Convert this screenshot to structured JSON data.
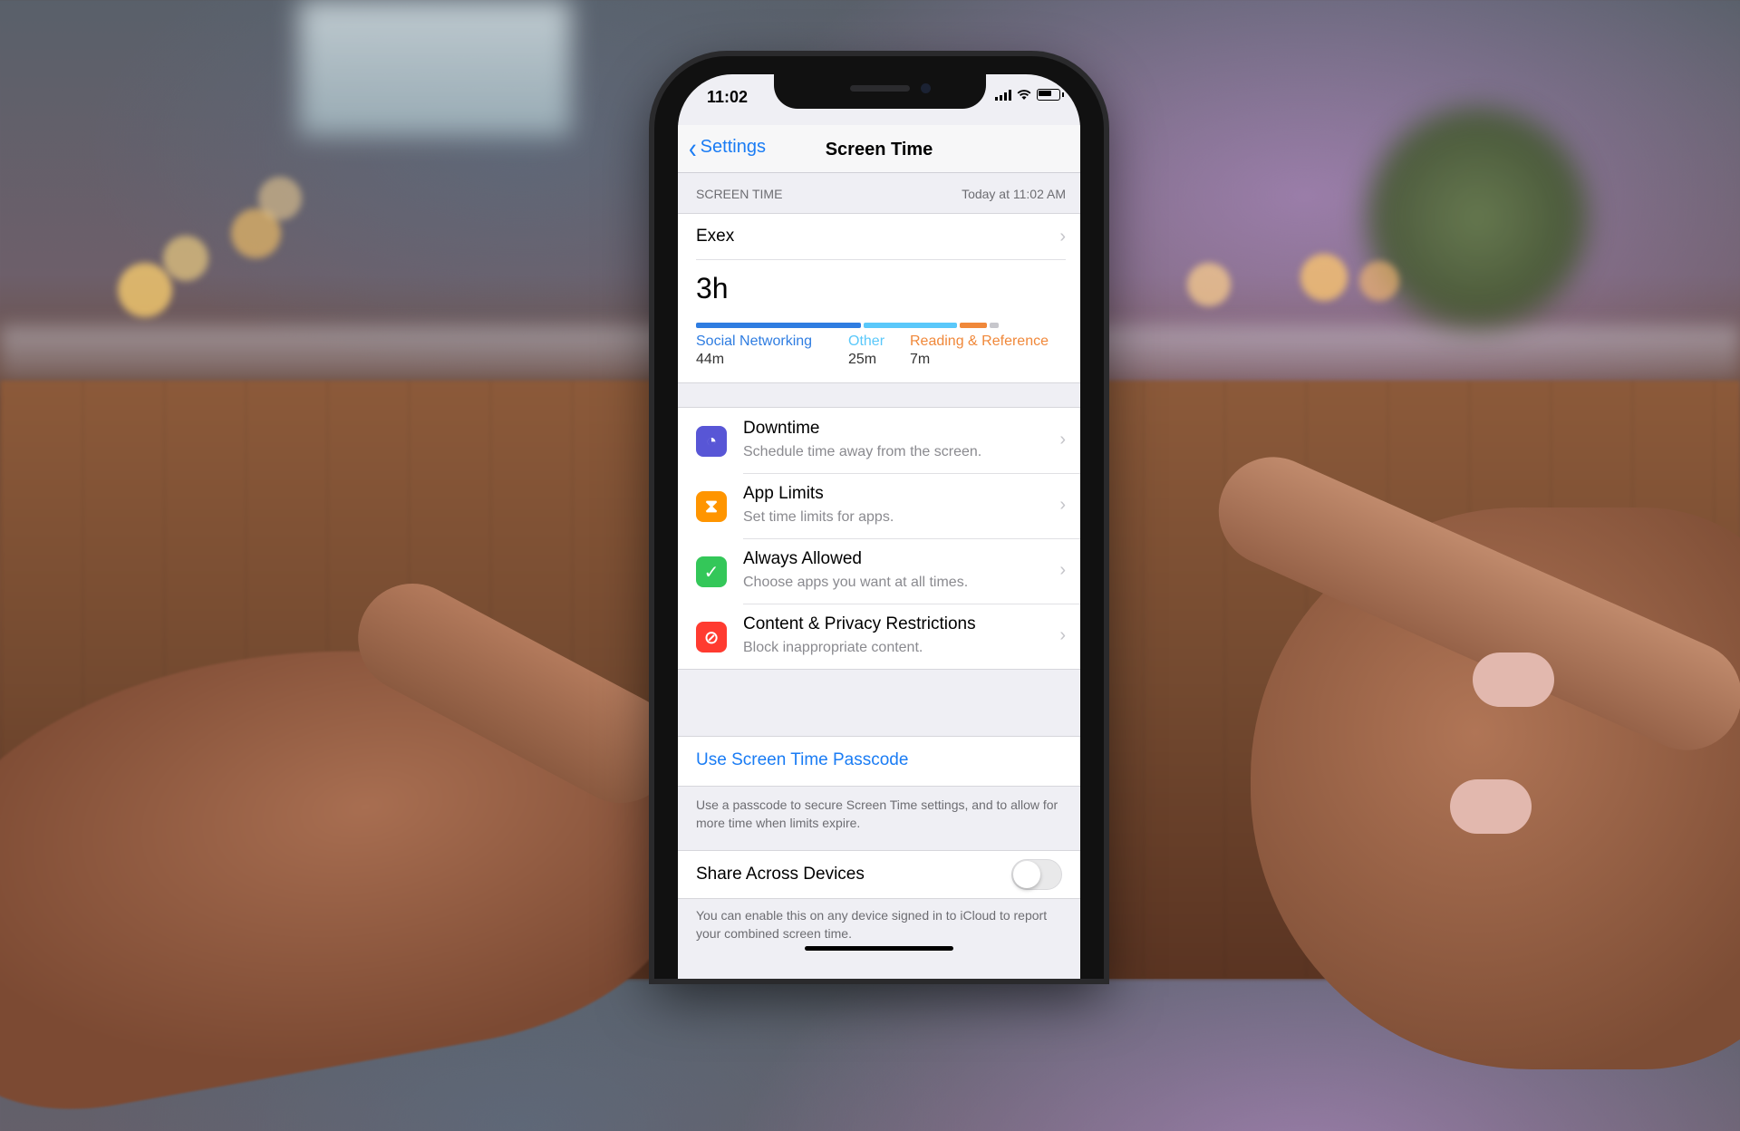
{
  "status_bar": {
    "time": "11:02",
    "icons": [
      "cellular-signal-icon",
      "wifi-icon",
      "battery-icon"
    ]
  },
  "nav": {
    "back_label": "Settings",
    "title": "Screen Time"
  },
  "summary": {
    "section_label": "SCREEN TIME",
    "updated": "Today at 11:02 AM",
    "device": "Exex",
    "total": "3h",
    "categories": [
      {
        "name": "Social Networking",
        "time": "44m",
        "color": "#2f7de1"
      },
      {
        "name": "Other",
        "time": "25m",
        "color": "#5ac8fa"
      },
      {
        "name": "Reading & Reference",
        "time": "7m",
        "color": "#f0883a"
      }
    ],
    "bar_remainder_color": "#c7c7cc"
  },
  "settings": [
    {
      "title": "Downtime",
      "subtitle": "Schedule time away from the screen.",
      "icon": "downtime-icon",
      "color": "#5856d6"
    },
    {
      "title": "App Limits",
      "subtitle": "Set time limits for apps.",
      "icon": "hourglass-icon",
      "color": "#ff9500"
    },
    {
      "title": "Always Allowed",
      "subtitle": "Choose apps you want at all times.",
      "icon": "checkmark-badge-icon",
      "color": "#34c759"
    },
    {
      "title": "Content & Privacy Restrictions",
      "subtitle": "Block inappropriate content.",
      "icon": "restriction-icon",
      "color": "#ff3b30"
    }
  ],
  "passcode": {
    "label": "Use Screen Time Passcode",
    "footer": "Use a passcode to secure Screen Time settings, and to allow for more time when limits expire."
  },
  "share": {
    "label": "Share Across Devices",
    "enabled": false,
    "footer": "You can enable this on any device signed in to iCloud to report your combined screen time."
  }
}
